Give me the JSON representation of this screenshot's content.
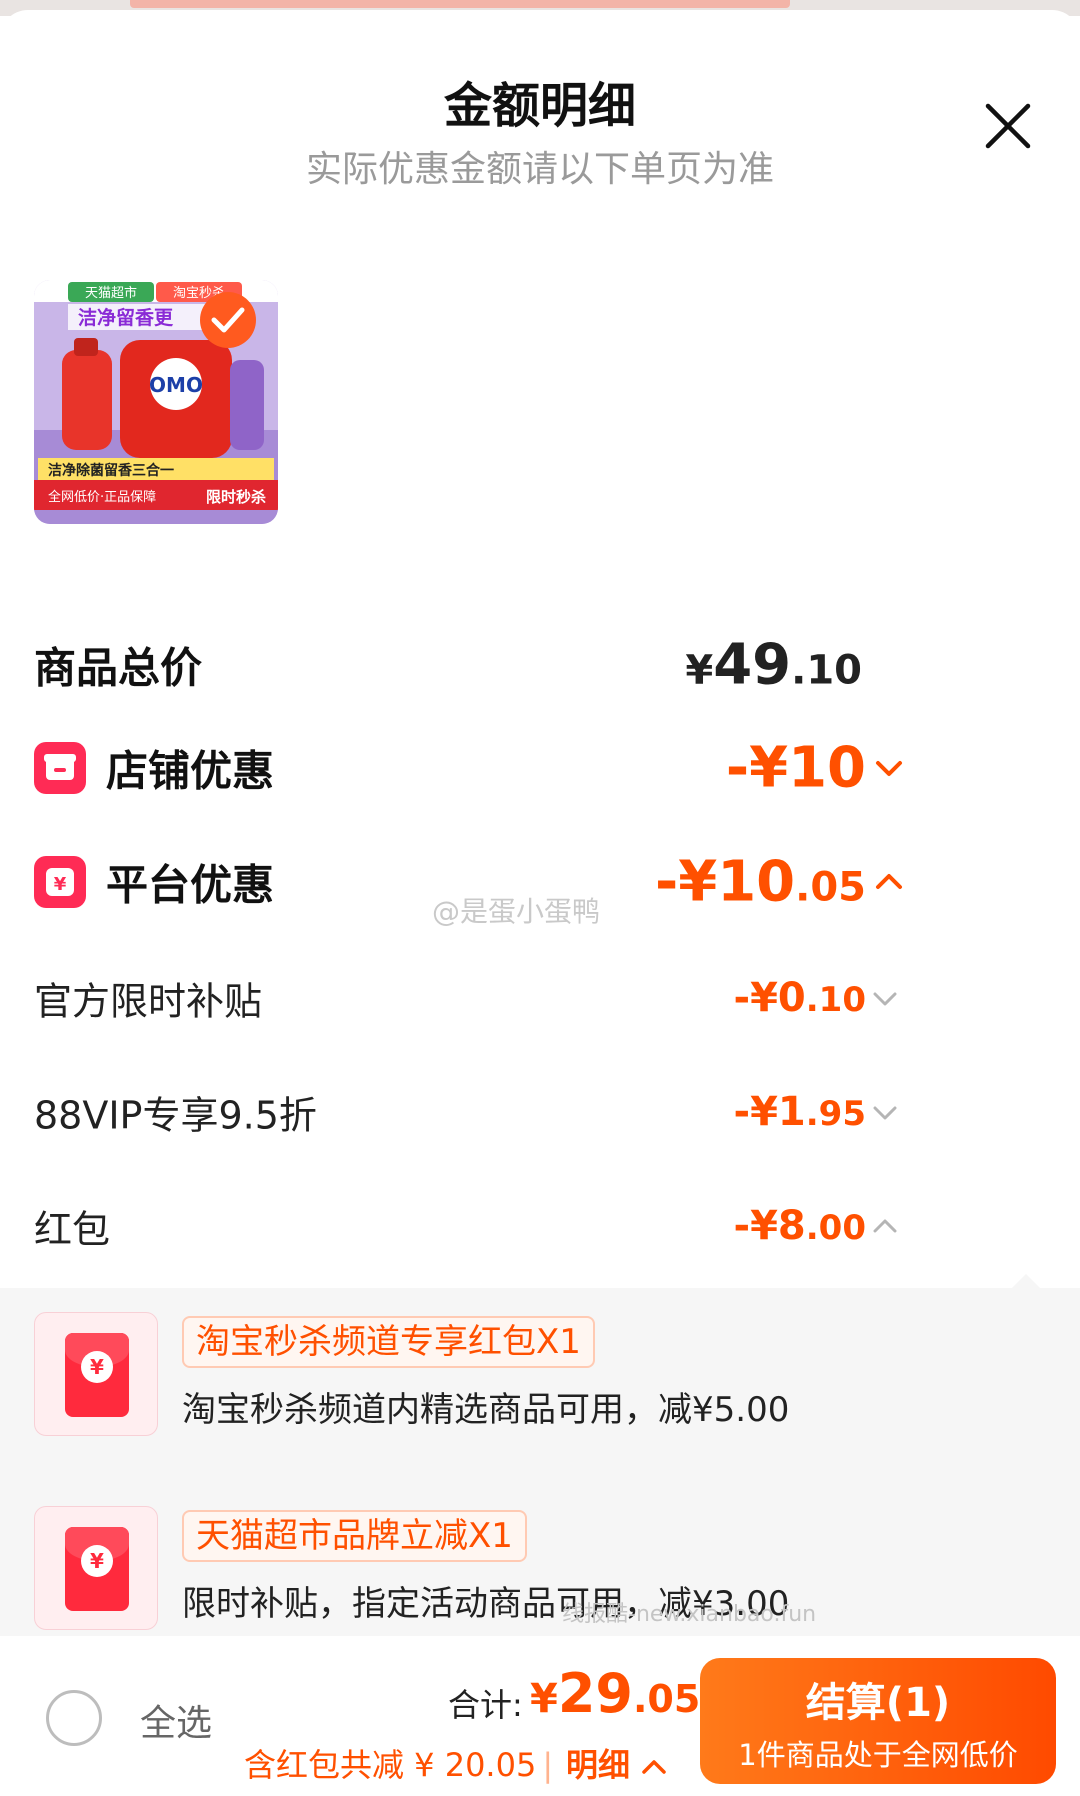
{
  "sheet": {
    "title": "金额明细",
    "subtitle": "实际优惠金额请以下单页为准",
    "close_icon": "close-icon"
  },
  "product": {
    "image_icon": "product-thumbnail",
    "badges": [
      "天猫超市",
      "淘宝秒杀"
    ],
    "headline": "洁净留香更",
    "brand": "OMO",
    "banner": "洁净除菌留香三合一",
    "footer_left": "全网低价·正品保障",
    "footer_right": "限时秒杀",
    "selected": true
  },
  "summary": {
    "total": {
      "label": "商品总价",
      "currency": "¥",
      "int": "49",
      "dec": ".10"
    },
    "shop": {
      "label": "店铺优惠",
      "amount": "-¥10",
      "icon": "shop-icon",
      "expanded": false
    },
    "platform": {
      "label": "平台优惠",
      "int": "-¥10",
      "dec": ".05",
      "icon": "platform-coupon-icon",
      "expanded": true
    },
    "subsidy": {
      "label": "官方限时补贴",
      "int": "-¥0",
      "dec": ".10"
    },
    "vip": {
      "label": "88VIP专享9.5折",
      "int": "-¥1",
      "dec": ".95"
    },
    "redpacket": {
      "label": "红包",
      "int": "-¥8",
      "dec": ".00",
      "expanded": true
    }
  },
  "redpackets": [
    {
      "tag": "淘宝秒杀频道专享红包X1",
      "desc": "淘宝秒杀频道内精选商品可用，减¥5.00",
      "icon": "red-envelope-icon"
    },
    {
      "tag": "天猫超市品牌立减X1",
      "desc": "限时补贴，指定活动商品可用，减¥3.00",
      "icon": "red-envelope-icon"
    }
  ],
  "watermarks": {
    "weibo": "@是蛋小蛋鸭",
    "site": "线报酷-new.xianbao.fun"
  },
  "footer": {
    "select_all": "全选",
    "sum_label": "合计:",
    "sum_currency": "¥",
    "sum_int": "29",
    "sum_dec": ".05",
    "saved": "含红包共减 ¥ 20.05",
    "detail": "明细",
    "checkout": "结算(1)",
    "checkout_sub": "1件商品处于全网低价"
  },
  "colors": {
    "accent": "#ff5000",
    "coupon_red": "#ff2b55",
    "muted": "#9a9a9a"
  }
}
